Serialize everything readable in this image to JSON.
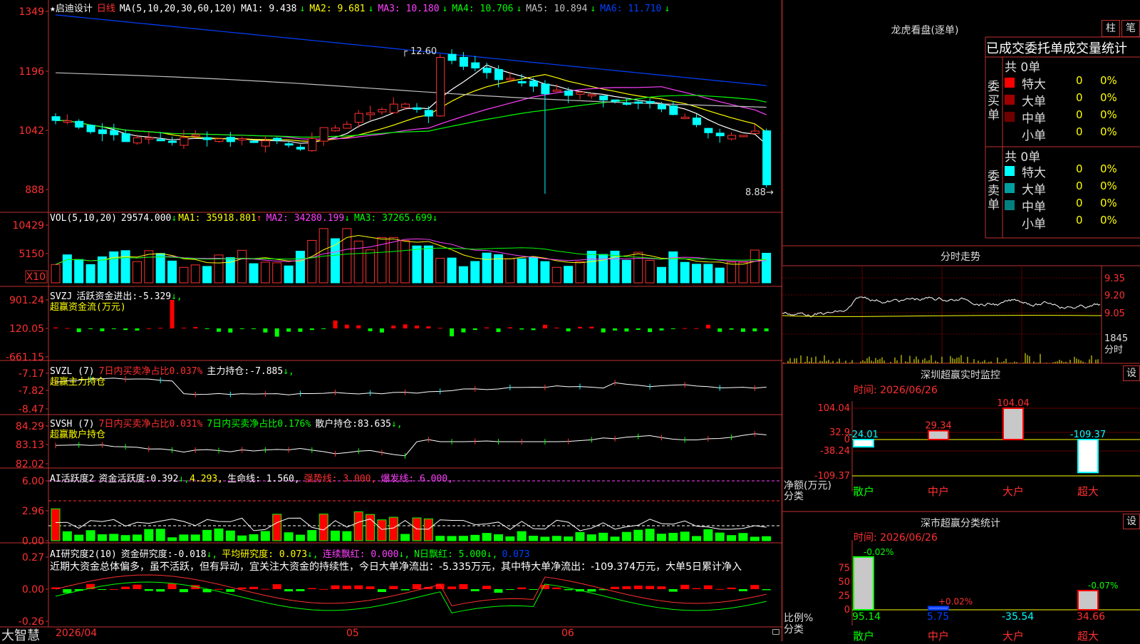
{
  "title": {
    "star": "★",
    "name": "启迪设计",
    "period": "日线",
    "ma_params": "MA(5,10,20,30,60,120)"
  },
  "ma_values": [
    {
      "label": "MA1:",
      "value": "9.438",
      "arrow": "↓",
      "color": "#ffffff"
    },
    {
      "label": "MA2:",
      "value": "9.681",
      "arrow": "↓",
      "color": "#ffff00"
    },
    {
      "label": "MA3:",
      "value": "10.180",
      "arrow": "↓",
      "color": "#ff40ff"
    },
    {
      "label": "MA4:",
      "value": "10.706",
      "arrow": "↓",
      "color": "#00ff00"
    },
    {
      "label": "MA5:",
      "value": "10.894",
      "arrow": "↓",
      "color": "#c0c0c0"
    },
    {
      "label": "MA6:",
      "value": "11.710",
      "arrow": "↓",
      "color": "#0040ff"
    }
  ],
  "main_axis": [
    "1349",
    "1196",
    "1042",
    "888"
  ],
  "main_annotations": {
    "high": "12.60",
    "low": "8.88"
  },
  "vol_header": {
    "name": "VOL(5,10,20)",
    "v": "29574.000",
    "v_arrow": "↓",
    "ma1": "MA1: 35918.801",
    "ma1_arrow": "↑",
    "ma2": "MA2: 34280.199",
    "ma2_arrow": "↓",
    "ma3": "MA3: 37265.699",
    "ma3_arrow": "↓"
  },
  "vol_axis": [
    "10429",
    "5150",
    "X10"
  ],
  "svzj_header": {
    "name": "SVZJ",
    "label": "活跃资金进出:",
    "value": "-5.329",
    "arrow": "↓,",
    "sub": "超赢资金流(万元)"
  },
  "svzj_axis": [
    "901.24",
    "120.05",
    "-661.15"
  ],
  "svzl_header": {
    "name": "SVZL (7)",
    "ratio": "7日内买卖净占比0.037%",
    "label": "主力持仓:",
    "value": "-7.885",
    "arrow": "↓,",
    "sub": "超赢主力持仓"
  },
  "svzl_axis": [
    "-7.17",
    "-7.82",
    "-8.47"
  ],
  "svsh_header": {
    "name": "SVSH (7)",
    "ratio1": "7日内买卖净占比0.031%",
    "ratio2": "7日内买卖净占比0.176%",
    "label": "散户持仓:",
    "value": "83.635",
    "arrow": "↓,",
    "sub": "超赢散户持仓"
  },
  "svsh_axis": [
    "84.29",
    "83.13",
    "82.02"
  ],
  "ai1_header": {
    "name": "AI活跃度2",
    "label": "资金活跃度:",
    "value": "0.392",
    "arrow": "↓,",
    "v2": "4.293,",
    "life": "生命线: 1.560,",
    "strong": "强势线: 3.000,",
    "burst": "爆发线: 6.000,"
  },
  "ai1_axis": [
    "6.00",
    "2.96",
    "0.00"
  ],
  "ai2_header": {
    "name": "AI研究度2(10)",
    "label": "资金研究度:",
    "value": "-0.018",
    "arrow": "↓,",
    "avg": "平均研究度: 0.073",
    "avg_arrow": "↓,",
    "red": "连续飘红: 0.000",
    "red_arrow": "↓,",
    "nday": "N日飘红: 5.000",
    "nday_arrow": "↓,",
    "last": "0.073"
  },
  "ai2_axis": [
    "0.27",
    "0.00",
    "-0.26"
  ],
  "ai2_text": "近期大资金总体偏多，虽不活跃，但有异动，宜关注大资金的持续性，今日大单净流出：-5.335万元，其中特大单净流出：-109.374万元，大单5日累计净入",
  "bottom": {
    "brand": "大智慧",
    "date": "2026/04",
    "m5": "05",
    "m6": "06"
  },
  "right": {
    "lhkp_title": "龙虎看盘(逐单)",
    "btn1": "柱",
    "btn2": "笔",
    "stats_title": "已成交委托单成交量统计",
    "buy_total": "共 0单",
    "sell_total": "共 0单",
    "buy_label": "委买单",
    "sell_label": "委卖单",
    "buy_rows": [
      {
        "name": "特大",
        "count": "0",
        "pct": "0%",
        "color": "#ff0000"
      },
      {
        "name": "大单",
        "count": "0",
        "pct": "0%",
        "color": "#a00000"
      },
      {
        "name": "中单",
        "count": "0",
        "pct": "0%",
        "color": "#700000"
      },
      {
        "name": "小单",
        "count": "0",
        "pct": "0%",
        "color": ""
      }
    ],
    "sell_rows": [
      {
        "name": "特大",
        "count": "0",
        "pct": "0%",
        "color": "#00ffff"
      },
      {
        "name": "大单",
        "count": "0",
        "pct": "0%",
        "color": "#00a0a0"
      },
      {
        "name": "中单",
        "count": "0",
        "pct": "0%",
        "color": "#008080"
      },
      {
        "name": "小单",
        "count": "0",
        "pct": "0%",
        "color": ""
      }
    ],
    "fs_title": "分时走势",
    "fs_axis": [
      "9.35",
      "9.20",
      "9.05",
      "1845",
      "分时"
    ],
    "sz_title": "深圳超赢实时监控",
    "sz_set": "设",
    "sz_time": "时间: 2026/06/26",
    "sz_axis": [
      "104.04",
      "32.9",
      "0",
      "-38.24",
      "-109.37"
    ],
    "sz_yl1": "净额(万元)",
    "sz_yl2": "分类",
    "sz_cats": [
      "散户",
      "中户",
      "大户",
      "超大"
    ],
    "sz_values": [
      "-24.01",
      "29.34",
      "104.04",
      "-109.37"
    ],
    "sh_title": "深市超赢分类统计",
    "sh_set": "设",
    "sh_time": "时间: 2026/06/26",
    "sh_axis": [
      "75",
      "50",
      "25",
      "0"
    ],
    "sh_yl1": "比例%",
    "sh_yl2": "分类",
    "sh_cats": [
      "散户",
      "中户",
      "大户",
      "超大"
    ],
    "sh_top": [
      "-0.02%",
      "+0.02%",
      "",
      "-0.07%"
    ],
    "sh_values": [
      "95.14",
      "5.75",
      "-35.54",
      "34.66"
    ]
  }
}
